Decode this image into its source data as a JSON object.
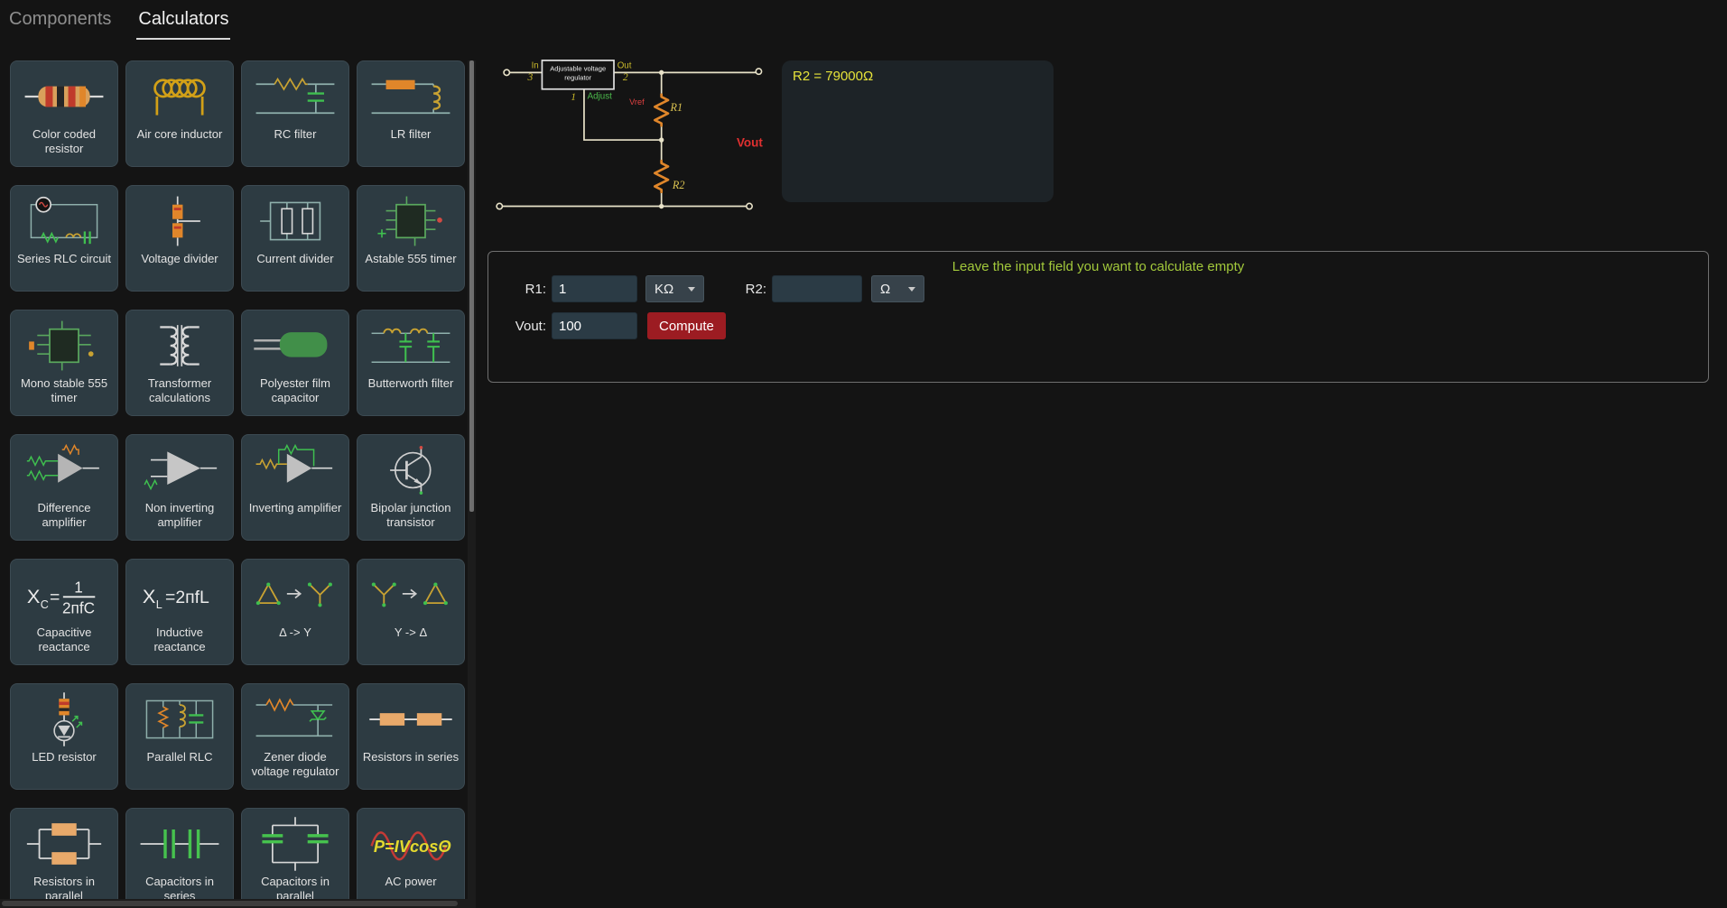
{
  "colors": {
    "background": "#141414",
    "card_background": "#2d3b42",
    "compute_button_red": "#9c1c22",
    "hint_green": "#a2c83b",
    "result_yellow": "#e6e33a",
    "wire_cream": "#e8e2c8",
    "resistor_orange": "#e0862a",
    "adjust_green": "#4cbb4c",
    "vout_red": "#e03030",
    "pin_yellow": "#c9b92a"
  },
  "tabs": [
    {
      "label": "Components",
      "active": false
    },
    {
      "label": "Calculators",
      "active": true
    }
  ],
  "sidebar": {
    "items": [
      {
        "label": "Color coded resistor",
        "icon": "color-coded-resistor-icon"
      },
      {
        "label": "Air core inductor",
        "icon": "air-core-inductor-icon"
      },
      {
        "label": "RC filter",
        "icon": "rc-filter-icon"
      },
      {
        "label": "LR filter",
        "icon": "lr-filter-icon"
      },
      {
        "label": "Series RLC circuit",
        "icon": "series-rlc-circuit-icon"
      },
      {
        "label": "Voltage divider",
        "icon": "voltage-divider-icon"
      },
      {
        "label": "Current divider",
        "icon": "current-divider-icon"
      },
      {
        "label": "Astable 555 timer",
        "icon": "astable-555-timer-icon"
      },
      {
        "label": "Mono stable 555 timer",
        "icon": "mono-stable-555-timer-icon"
      },
      {
        "label": "Transformer calculations",
        "icon": "transformer-calculations-icon"
      },
      {
        "label": "Polyester film capacitor",
        "icon": "polyester-film-capacitor-icon"
      },
      {
        "label": "Butterworth filter",
        "icon": "butterworth-filter-icon"
      },
      {
        "label": "Difference amplifier",
        "icon": "difference-amplifier-icon"
      },
      {
        "label": "Non inverting amplifier",
        "icon": "non-inverting-amplifier-icon"
      },
      {
        "label": "Inverting amplifier",
        "icon": "inverting-amplifier-icon"
      },
      {
        "label": "Bipolar junction transistor",
        "icon": "bipolar-junction-transistor-icon"
      },
      {
        "label": "Capacitive reactance",
        "icon": "capacitive-reactance-formula-icon",
        "formula": {
          "sym": "X",
          "sub": "C",
          "eq": "=",
          "num": "1",
          "den": "2пfC"
        }
      },
      {
        "label": "Inductive reactance",
        "icon": "inductive-reactance-formula-icon",
        "formula": {
          "sym": "X",
          "sub": "L",
          "eq": "=",
          "rhs": "2пfL"
        }
      },
      {
        "label": "Δ -> Y",
        "icon": "delta-to-y-icon"
      },
      {
        "label": "Y -> Δ",
        "icon": "y-to-delta-icon"
      },
      {
        "label": "LED resistor",
        "icon": "led-resistor-icon"
      },
      {
        "label": "Parallel RLC",
        "icon": "parallel-rlc-icon"
      },
      {
        "label": "Zener diode voltage regulator",
        "icon": "zener-diode-voltage-regulator-icon"
      },
      {
        "label": "Resistors in series",
        "icon": "resistors-in-series-icon"
      },
      {
        "label": "Resistors in parallel",
        "icon": "resistors-in-parallel-icon"
      },
      {
        "label": "Capacitors in series",
        "icon": "capacitors-in-series-icon"
      },
      {
        "label": "Capacitors in parallel",
        "icon": "capacitors-in-parallel-icon"
      },
      {
        "label": "AC power",
        "icon": "ac-power-formula-icon",
        "formula": {
          "text": "P=IVcosΘ"
        }
      }
    ]
  },
  "diagram": {
    "box_line1": "Adjustable voltage",
    "box_line2": "regulator",
    "pin_in": "In",
    "pin_in_num": "3",
    "pin_out": "Out",
    "pin_out_num": "2",
    "pin_adjust": "Adjust",
    "pin_adjust_num": "1",
    "vref": "Vref",
    "vout": "Vout",
    "r1": "R1",
    "r2": "R2"
  },
  "result": {
    "text": "R2 = 79000Ω"
  },
  "form": {
    "hint": "Leave the input field you want to calculate empty",
    "r1_label": "R1:",
    "r1_value": "1",
    "r1_unit": "KΩ",
    "r2_label": "R2:",
    "r2_value": "",
    "r2_unit": "Ω",
    "vout_label": "Vout:",
    "vout_value": "100",
    "compute_label": "Compute"
  }
}
